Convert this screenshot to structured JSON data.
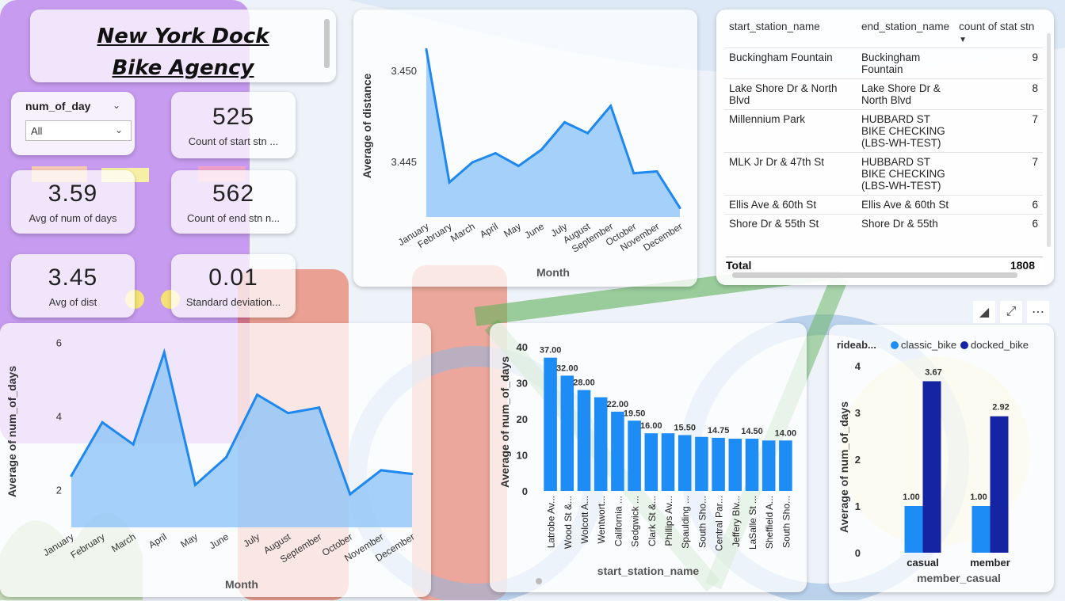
{
  "title": "New York Dock Bike Agency",
  "slicer": {
    "label": "num_of_day",
    "value": "All"
  },
  "kpis": [
    {
      "value": "525",
      "label": "Count of start stn ..."
    },
    {
      "value": "3.59",
      "label": "Avg of num of days"
    },
    {
      "value": "562",
      "label": "Count of end stn n..."
    },
    {
      "value": "3.45",
      "label": "Avg of dist"
    },
    {
      "value": "0.01",
      "label": "Standard deviation..."
    }
  ],
  "station_table": {
    "headers": [
      "start_station_name",
      "end_station_name",
      "count of stat stn"
    ],
    "rows": [
      [
        "Buckingham Fountain",
        "Buckingham Fountain",
        "9"
      ],
      [
        "Lake Shore Dr & North Blvd",
        "Lake Shore Dr & North Blvd",
        "8"
      ],
      [
        "Millennium Park",
        "HUBBARD ST BIKE CHECKING (LBS-WH-TEST)",
        "7"
      ],
      [
        "MLK Jr Dr & 47th St",
        "HUBBARD ST BIKE CHECKING (LBS-WH-TEST)",
        "7"
      ],
      [
        "Ellis Ave & 60th St",
        "Ellis Ave & 60th St",
        "6"
      ],
      [
        "Shore Dr & 55th St",
        "Shore Dr & 55th",
        "6"
      ]
    ],
    "total_label": "Total",
    "total_value": "1808"
  },
  "colors": {
    "area": "#8fc4f7",
    "line": "#1e88f0",
    "bar": "#1e8cf5",
    "dark_bar": "#1524a3"
  },
  "chart_data": [
    {
      "type": "area",
      "categories": [
        "January",
        "February",
        "March",
        "April",
        "May",
        "June",
        "July",
        "August",
        "September",
        "October",
        "November",
        "December"
      ],
      "values": [
        3.4512,
        3.4439,
        3.445,
        3.4455,
        3.4448,
        3.4457,
        3.4472,
        3.4466,
        3.4481,
        3.4444,
        3.4445,
        3.4425
      ],
      "xlabel": "Month",
      "ylabel": "Average of distance",
      "ylim": [
        3.442,
        3.452
      ],
      "yticks": [
        "3.450",
        "3.445"
      ]
    },
    {
      "type": "area",
      "categories": [
        "January",
        "February",
        "March",
        "April",
        "May",
        "June",
        "July",
        "August",
        "September",
        "October",
        "November",
        "December"
      ],
      "values": [
        2.4,
        3.85,
        3.25,
        5.75,
        2.15,
        2.9,
        4.6,
        4.1,
        4.25,
        1.9,
        2.55,
        2.45
      ],
      "xlabel": "Month",
      "ylabel": "Average of num_of_days",
      "ylim": [
        1.0,
        6.2
      ],
      "yticks": [
        "2",
        "4",
        "6"
      ]
    },
    {
      "type": "bar",
      "categories": [
        "Latrobe Av...",
        "Wood St &...",
        "Wolcott A...",
        "Wentwort...",
        "California ...",
        "Sedgwick ...",
        "Clark St &...",
        "Phillips Av...",
        "Spaulding ...",
        "South Sho...",
        "Central Par...",
        "Jeffery Blv...",
        "LaSalle St ...",
        "Sheffield A...",
        "South Sho..."
      ],
      "values": [
        37,
        32,
        28,
        26,
        22,
        19.5,
        16,
        16,
        15.5,
        15,
        14.75,
        14.5,
        14.5,
        14,
        14
      ],
      "labels": [
        "37.00",
        "32.00",
        "28.00",
        "",
        "22.00",
        "19.50",
        "16.00",
        "",
        "15.50",
        "",
        "14.75",
        "",
        "14.50",
        "",
        "14.00"
      ],
      "xlabel": "start_station_name",
      "ylabel": "Average of num_of_days",
      "ylim": [
        0,
        40
      ],
      "yticks": [
        "0",
        "10",
        "20",
        "30",
        "40"
      ]
    },
    {
      "type": "bar",
      "categories": [
        "casual",
        "member"
      ],
      "series": [
        {
          "name": "classic_bike",
          "values": [
            1.0,
            1.0
          ],
          "labels": [
            "1.00",
            "1.00"
          ]
        },
        {
          "name": "docked_bike",
          "values": [
            3.67,
            2.92
          ],
          "labels": [
            "3.67",
            "2.92"
          ]
        }
      ],
      "legend_title": "rideab...",
      "xlabel": "member_casual",
      "ylabel": "Average of num_of_days",
      "ylim": [
        0,
        4
      ],
      "yticks": [
        "0",
        "1",
        "2",
        "3",
        "4"
      ]
    }
  ]
}
